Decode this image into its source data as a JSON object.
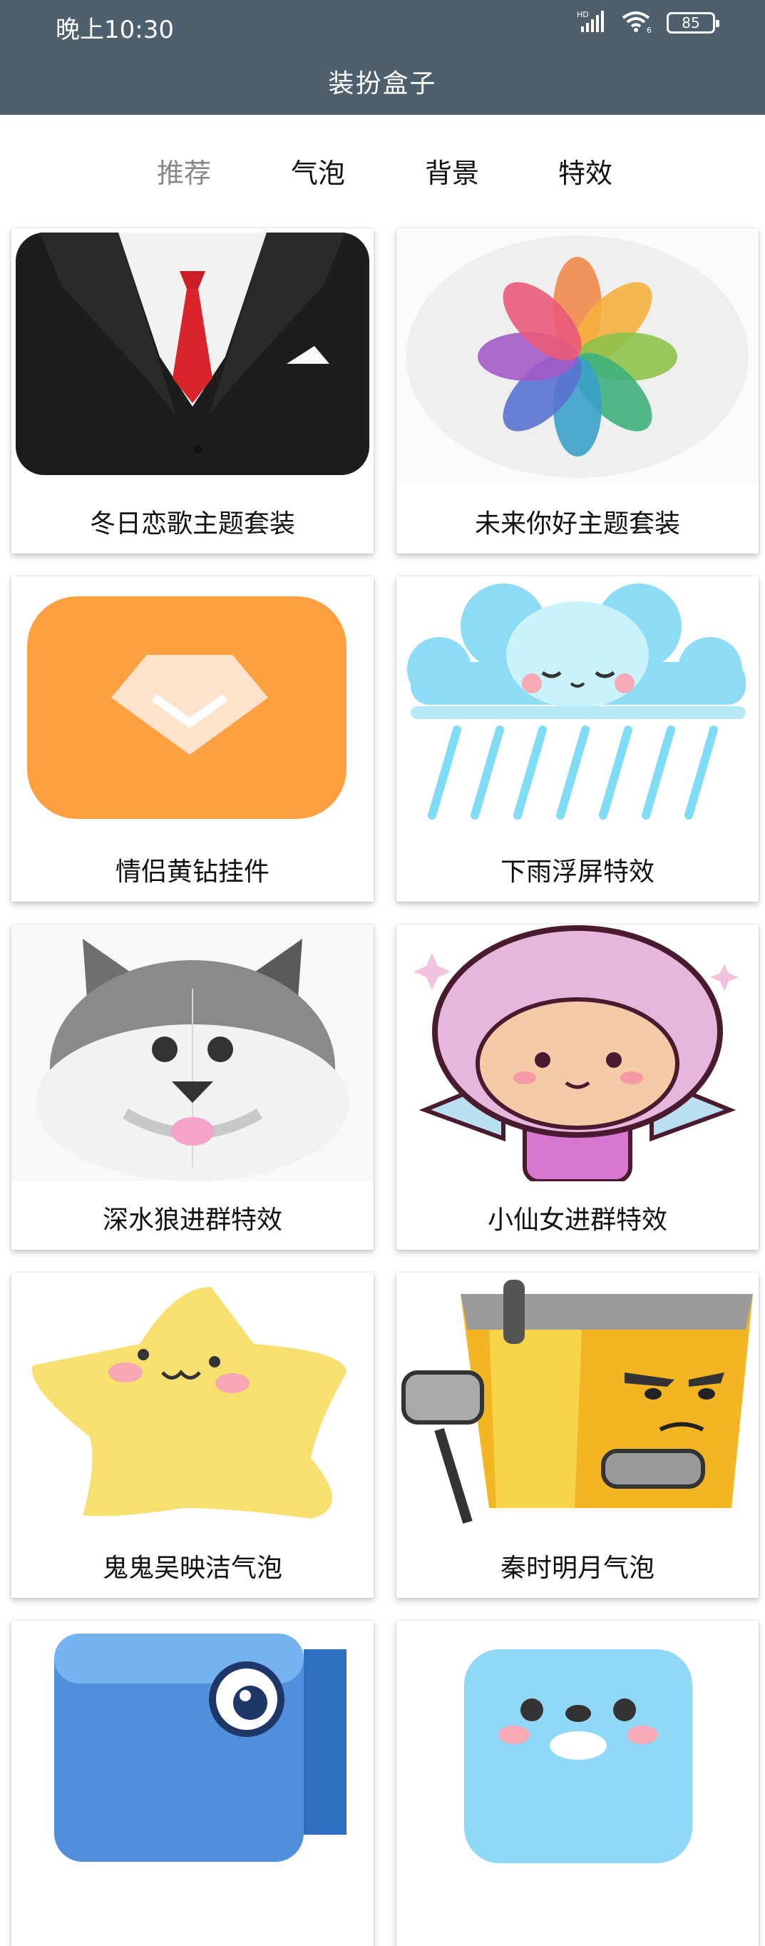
{
  "status": {
    "time": "晚上10:30",
    "network": "HD",
    "wifi_sub": "6",
    "battery": "85"
  },
  "app": {
    "title": "装扮盒子"
  },
  "tabs": [
    {
      "label": "推荐",
      "active": true
    },
    {
      "label": "气泡",
      "active": false
    },
    {
      "label": "背景",
      "active": false
    },
    {
      "label": "特效",
      "active": false
    }
  ],
  "items": [
    {
      "label": "冬日恋歌主题套装",
      "icon": "suit-icon"
    },
    {
      "label": "未来你好主题套装",
      "icon": "flower-petals-icon"
    },
    {
      "label": "情侣黄钻挂件",
      "icon": "diamond-icon"
    },
    {
      "label": "下雨浮屏特效",
      "icon": "rain-cloud-icon"
    },
    {
      "label": "深水狼进群特效",
      "icon": "husky-icon"
    },
    {
      "label": "小仙女进群特效",
      "icon": "fairy-icon"
    },
    {
      "label": "鬼鬼吴映洁气泡",
      "icon": "star-face-icon"
    },
    {
      "label": "秦时明月气泡",
      "icon": "box-robot-icon"
    },
    {
      "label": "",
      "icon": "blue-block-icon"
    },
    {
      "label": "",
      "icon": "blue-face-icon"
    }
  ],
  "colors": {
    "header": "#4e5f6e",
    "active_tab": "#888888"
  }
}
